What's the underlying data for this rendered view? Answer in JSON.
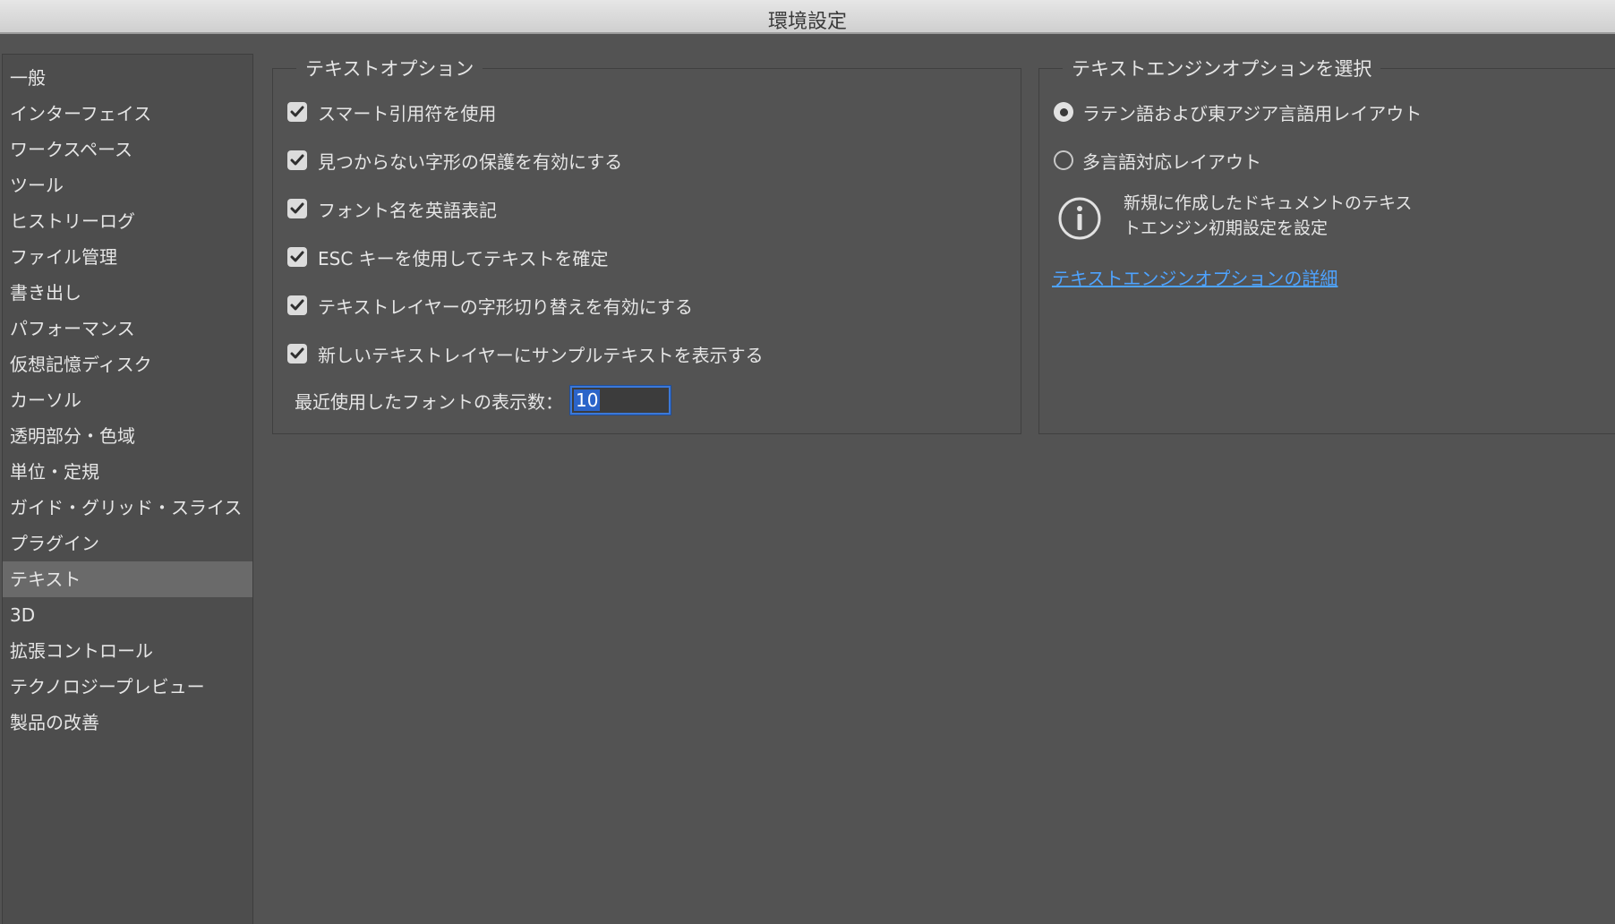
{
  "window": {
    "title": "環境設定"
  },
  "sidebar": {
    "items": [
      {
        "label": "一般"
      },
      {
        "label": "インターフェイス"
      },
      {
        "label": "ワークスペース"
      },
      {
        "label": "ツール"
      },
      {
        "label": "ヒストリーログ"
      },
      {
        "label": "ファイル管理"
      },
      {
        "label": "書き出し"
      },
      {
        "label": "パフォーマンス"
      },
      {
        "label": "仮想記憶ディスク"
      },
      {
        "label": "カーソル"
      },
      {
        "label": "透明部分・色域"
      },
      {
        "label": "単位・定規"
      },
      {
        "label": "ガイド・グリッド・スライス"
      },
      {
        "label": "プラグイン"
      },
      {
        "label": "テキスト",
        "selected": true
      },
      {
        "label": "3D"
      },
      {
        "label": "拡張コントロール"
      },
      {
        "label": "テクノロジープレビュー"
      },
      {
        "label": "製品の改善"
      }
    ]
  },
  "text_options": {
    "legend": "テキストオプション",
    "checkboxes": [
      {
        "label": "スマート引用符を使用",
        "checked": true
      },
      {
        "label": "見つからない字形の保護を有効にする",
        "checked": true
      },
      {
        "label": "フォント名を英語表記",
        "checked": true
      },
      {
        "label": "ESC キーを使用してテキストを確定",
        "checked": true
      },
      {
        "label": "テキストレイヤーの字形切り替えを有効にする",
        "checked": true
      },
      {
        "label": "新しいテキストレイヤーにサンプルテキストを表示する",
        "checked": true
      }
    ],
    "recent_fonts_label": "最近使用したフォントの表示数：",
    "recent_fonts_value": "10"
  },
  "engine_options": {
    "legend": "テキストエンジンオプションを選択",
    "radios": [
      {
        "label": "ラテン語および東アジア言語用レイアウト",
        "selected": true
      },
      {
        "label": "多言語対応レイアウト",
        "selected": false
      }
    ],
    "info_line1": "新規に作成したドキュメントのテキス",
    "info_line2": "トエンジン初期設定を設定",
    "link": "テキストエンジンオプションの詳細"
  },
  "colors": {
    "background": "#535353",
    "sidebar_selected": "#6a6a6a",
    "link": "#4ea3ff",
    "input_focus": "#3b78d8"
  }
}
